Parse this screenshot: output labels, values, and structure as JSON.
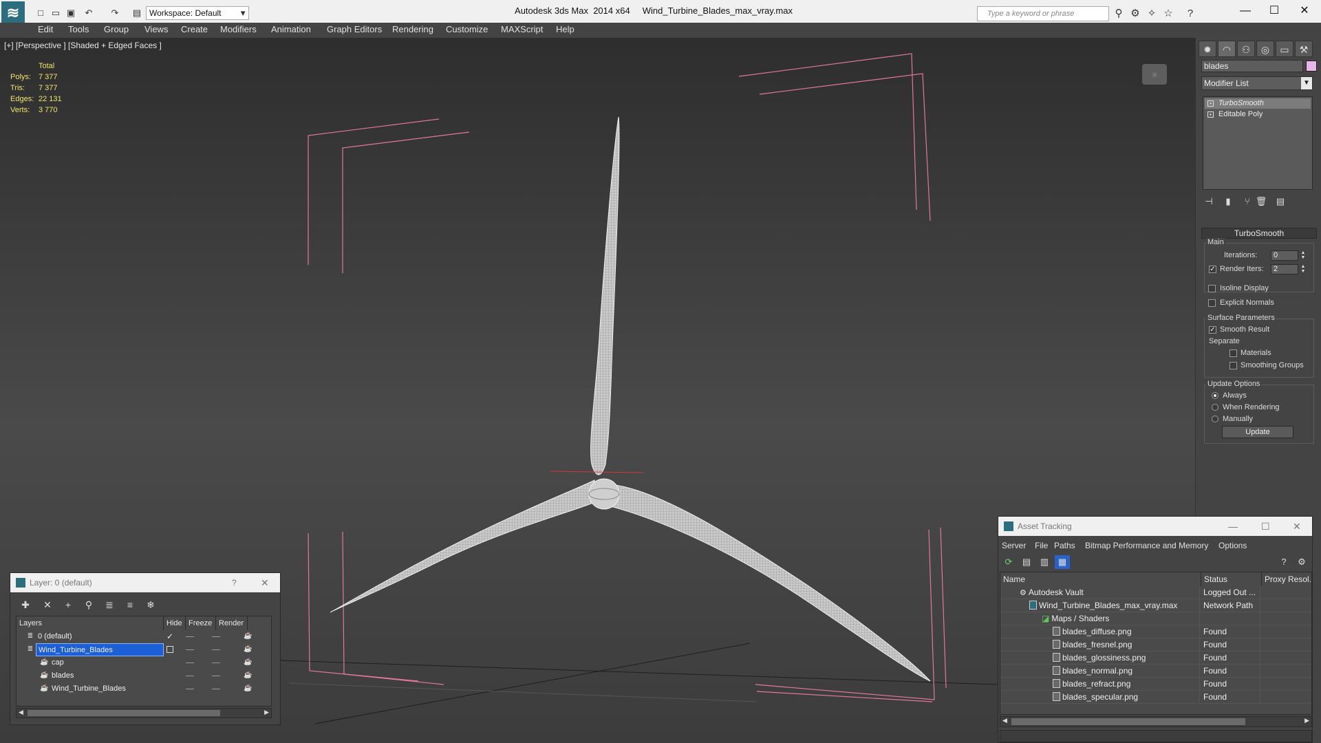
{
  "app": {
    "title": "Autodesk 3ds Max  2014 x64     Wind_Turbine_Blades_max_vray.max",
    "workspace": "Workspace: Default",
    "search_placeholder": "Type a keyword or phrase"
  },
  "menu": [
    "Edit",
    "Tools",
    "Group",
    "Views",
    "Create",
    "Modifiers",
    "Animation",
    "Graph Editors",
    "Rendering",
    "Customize",
    "MAXScript",
    "Help"
  ],
  "viewport": {
    "label": "[+] [Perspective ] [Shaded + Edged Faces ]",
    "stats": {
      "header": "Total",
      "rows": [
        {
          "label": "Polys:",
          "value": "7 377"
        },
        {
          "label": "Tris:",
          "value": "7 377"
        },
        {
          "label": "Edges:",
          "value": "22 131"
        },
        {
          "label": "Verts:",
          "value": "3 770"
        }
      ]
    }
  },
  "command_panel": {
    "object_name": "blades",
    "object_color": "#e7b5e8",
    "modifier_list": "Modifier List",
    "stack": [
      "TurboSmooth",
      "Editable Poly"
    ],
    "rollout_title": "TurboSmooth",
    "main_group": "Main",
    "iterations_label": "Iterations:",
    "iterations_value": "0",
    "render_iters_label": "Render Iters:",
    "render_iters_value": "2",
    "isoline": "Isoline Display",
    "explicit_normals": "Explicit Normals",
    "surface_group": "Surface Parameters",
    "smooth_result": "Smooth Result",
    "separate": "Separate",
    "materials": "Materials",
    "smoothing_groups": "Smoothing Groups",
    "update_group": "Update Options",
    "always": "Always",
    "when_rendering": "When Rendering",
    "manually": "Manually",
    "update_button": "Update"
  },
  "layer_window": {
    "title": "Layer: 0 (default)",
    "help": "?",
    "close": "✕",
    "columns": [
      "Layers",
      "Hide",
      "Freeze",
      "Render"
    ],
    "rows": [
      {
        "name": "0 (default)",
        "indent": 0
      },
      {
        "name": "Wind_Turbine_Blades",
        "indent": 0
      },
      {
        "name": "cap",
        "indent": 1
      },
      {
        "name": "blades",
        "indent": 1
      },
      {
        "name": "Wind_Turbine_Blades",
        "indent": 1
      }
    ]
  },
  "asset_tracking": {
    "title": "Asset Tracking",
    "menu": [
      "Server",
      "File",
      "Paths",
      "Bitmap Performance and Memory",
      "Options"
    ],
    "columns": [
      "Name",
      "Status",
      "Proxy Resol..."
    ],
    "rows": [
      {
        "name": "Autodesk Vault",
        "status": "Logged Out ...",
        "indent": 1
      },
      {
        "name": "Wind_Turbine_Blades_max_vray.max",
        "status": "Network Path",
        "indent": 2
      },
      {
        "name": "Maps / Shaders",
        "status": "",
        "indent": 3
      },
      {
        "name": "blades_diffuse.png",
        "status": "Found",
        "indent": 4
      },
      {
        "name": "blades_fresnel.png",
        "status": "Found",
        "indent": 4
      },
      {
        "name": "blades_glossiness.png",
        "status": "Found",
        "indent": 4
      },
      {
        "name": "blades_normal.png",
        "status": "Found",
        "indent": 4
      },
      {
        "name": "blades_refract.png",
        "status": "Found",
        "indent": 4
      },
      {
        "name": "blades_specular.png",
        "status": "Found",
        "indent": 4
      }
    ]
  }
}
